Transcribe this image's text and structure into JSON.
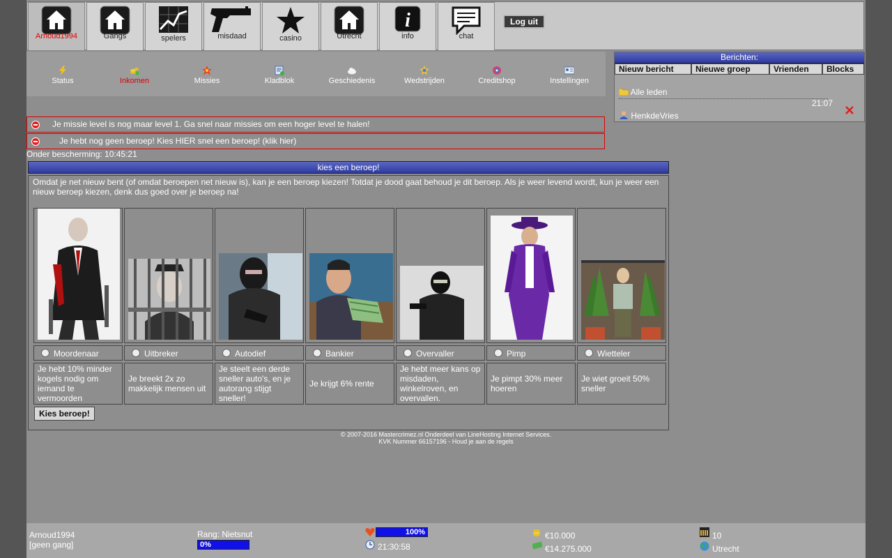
{
  "topnav": {
    "items": [
      {
        "label": "Arnoud1994",
        "icon": "home-icon"
      },
      {
        "label": "Gangs",
        "icon": "home-icon"
      },
      {
        "label": "spelers",
        "icon": "chart-icon"
      },
      {
        "label": "misdaad",
        "icon": "gun-icon"
      },
      {
        "label": "casino",
        "icon": "star-icon"
      },
      {
        "label": "Utrecht",
        "icon": "home-icon"
      },
      {
        "label": "info",
        "icon": "info-icon"
      },
      {
        "label": "chat",
        "icon": "chat-icon"
      }
    ],
    "logout_label": "Log uit"
  },
  "subnav": {
    "items": [
      {
        "label": "Status",
        "icon": "lightning-icon"
      },
      {
        "label": "Inkomen",
        "icon": "coins-icon"
      },
      {
        "label": "Missies",
        "icon": "star-badge-icon"
      },
      {
        "label": "Kladblok",
        "icon": "notepad-icon"
      },
      {
        "label": "Geschiedenis",
        "icon": "cloud-icon"
      },
      {
        "label": "Wedstrijden",
        "icon": "medal-icon"
      },
      {
        "label": "Creditshop",
        "icon": "shop-icon"
      },
      {
        "label": "Instellingen",
        "icon": "id-card-icon"
      }
    ]
  },
  "berichten": {
    "title": "Berichten:",
    "tabs": [
      "Nieuw bericht",
      "Nieuwe groep",
      "Vrienden",
      "Blocks"
    ],
    "group": "Alle leden",
    "time": "21:07",
    "sender": "HenkdeVries"
  },
  "alerts": [
    "Je missie level is nog maar level 1. Ga snel naar missies om een hoger level te halen!",
    "Je hebt nog geen beroep! Kies HIER snel een beroep! (klik hier)"
  ],
  "protection": "Onder bescherming: 10:45:21",
  "beroep": {
    "title": "kies een beroep!",
    "intro": "Omdat je net nieuw bent (of omdat beroepen net nieuw is), kan je een beroep kiezen! Totdat je dood gaat behoud je dit beroep. Als je weer levend wordt, kun je weer een nieuw beroep kiezen, denk dus goed over je beroep na!",
    "jobs": [
      {
        "name": "Moordenaar",
        "desc": "Je hebt 10% minder kogels nodig om iemand te vermoorden"
      },
      {
        "name": "Uitbreker",
        "desc": "Je breekt 2x zo makkelijk mensen uit"
      },
      {
        "name": "Autodief",
        "desc": "Je steelt een derde sneller auto's, en je autorang stijgt sneller!"
      },
      {
        "name": "Bankier",
        "desc": "Je krijgt 6% rente"
      },
      {
        "name": "Overvaller",
        "desc": "Je hebt meer kans op misdaden, winkelroven, en overvallen."
      },
      {
        "name": "Pimp",
        "desc": "Je pimpt 30% meer hoeren"
      },
      {
        "name": "Wietteler",
        "desc": "Je wiet groeit 50% sneller"
      }
    ],
    "button": "Kies beroep!"
  },
  "footer": {
    "line1": "© 2007-2016 Mastercrimez.nl Onderdeel van LineHosting Internet Services.",
    "line2": "KVK Nummer 66157196 - Houd je aan de regels"
  },
  "bottombar": {
    "username": "Arnoud1994",
    "gang": "[geen gang]",
    "rank": "Rang: Nietsnut",
    "rank_progress_label": "0%",
    "rank_progress": 0,
    "health_label": "100%",
    "health": 100,
    "clock": "21:30:58",
    "cash": "€10.000",
    "bank": "€14.275.000",
    "bullets": "10",
    "city": "Utrecht"
  }
}
